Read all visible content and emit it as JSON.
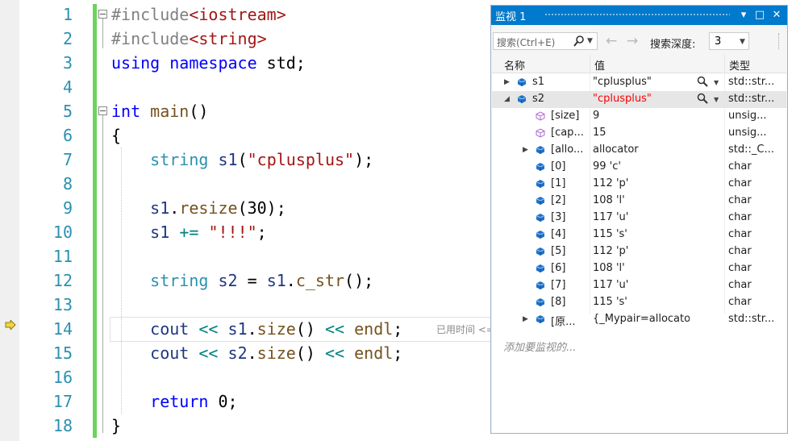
{
  "editor": {
    "line_numbers": [
      "1",
      "2",
      "3",
      "4",
      "5",
      "6",
      "7",
      "8",
      "9",
      "10",
      "11",
      "12",
      "13",
      "14",
      "15",
      "16",
      "17",
      "18"
    ],
    "lines": [
      [
        {
          "c": "p",
          "t": "#include"
        },
        {
          "c": "s",
          "t": "<iostream>"
        }
      ],
      [
        {
          "c": "p",
          "t": "#include"
        },
        {
          "c": "s",
          "t": "<string>"
        }
      ],
      [
        {
          "c": "k",
          "t": "using"
        },
        {
          "c": "",
          "t": " "
        },
        {
          "c": "k",
          "t": "namespace"
        },
        {
          "c": "",
          "t": " std;"
        }
      ],
      [],
      [
        {
          "c": "k",
          "t": "int"
        },
        {
          "c": "",
          "t": " "
        },
        {
          "c": "f",
          "t": "main"
        },
        {
          "c": "",
          "t": "()"
        }
      ],
      [
        {
          "c": "",
          "t": "{"
        }
      ],
      [
        {
          "c": "",
          "t": "    "
        },
        {
          "c": "t",
          "t": "string"
        },
        {
          "c": "",
          "t": " "
        },
        {
          "c": "v",
          "t": "s1"
        },
        {
          "c": "",
          "t": "("
        },
        {
          "c": "s",
          "t": "\"cplusplus\""
        },
        {
          "c": "",
          "t": ");"
        }
      ],
      [],
      [
        {
          "c": "",
          "t": "    "
        },
        {
          "c": "v",
          "t": "s1"
        },
        {
          "c": "",
          "t": "."
        },
        {
          "c": "f",
          "t": "resize"
        },
        {
          "c": "",
          "t": "(30);"
        }
      ],
      [
        {
          "c": "",
          "t": "    "
        },
        {
          "c": "v",
          "t": "s1"
        },
        {
          "c": "",
          "t": " "
        },
        {
          "c": "o",
          "t": "+="
        },
        {
          "c": "",
          "t": " "
        },
        {
          "c": "s",
          "t": "\"!!!\""
        },
        {
          "c": "",
          "t": ";"
        }
      ],
      [],
      [
        {
          "c": "",
          "t": "    "
        },
        {
          "c": "t",
          "t": "string"
        },
        {
          "c": "",
          "t": " "
        },
        {
          "c": "v",
          "t": "s2"
        },
        {
          "c": "",
          "t": " = "
        },
        {
          "c": "v",
          "t": "s1"
        },
        {
          "c": "",
          "t": "."
        },
        {
          "c": "f",
          "t": "c_str"
        },
        {
          "c": "",
          "t": "();"
        }
      ],
      [],
      [
        {
          "c": "",
          "t": "    "
        },
        {
          "c": "v",
          "t": "cout"
        },
        {
          "c": "",
          "t": " "
        },
        {
          "c": "o",
          "t": "<<"
        },
        {
          "c": "",
          "t": " "
        },
        {
          "c": "v",
          "t": "s1"
        },
        {
          "c": "",
          "t": "."
        },
        {
          "c": "f",
          "t": "size"
        },
        {
          "c": "",
          "t": "() "
        },
        {
          "c": "o",
          "t": "<<"
        },
        {
          "c": "",
          "t": " "
        },
        {
          "c": "f",
          "t": "endl"
        },
        {
          "c": "",
          "t": ";"
        }
      ],
      [
        {
          "c": "",
          "t": "    "
        },
        {
          "c": "v",
          "t": "cout"
        },
        {
          "c": "",
          "t": " "
        },
        {
          "c": "o",
          "t": "<<"
        },
        {
          "c": "",
          "t": " "
        },
        {
          "c": "v",
          "t": "s2"
        },
        {
          "c": "",
          "t": "."
        },
        {
          "c": "f",
          "t": "size"
        },
        {
          "c": "",
          "t": "() "
        },
        {
          "c": "o",
          "t": "<<"
        },
        {
          "c": "",
          "t": " "
        },
        {
          "c": "f",
          "t": "endl"
        },
        {
          "c": "",
          "t": ";"
        }
      ],
      [],
      [
        {
          "c": "",
          "t": "    "
        },
        {
          "c": "k",
          "t": "return"
        },
        {
          "c": "",
          "t": " 0;"
        }
      ],
      [
        {
          "c": "",
          "t": "}"
        }
      ]
    ],
    "perf_tip": "已用时间 <="
  },
  "watch": {
    "title": "监视 1",
    "buttons": {
      "dropdown": "▾",
      "maximize": "□",
      "close": "✕"
    },
    "search_placeholder": "搜索(Ctrl+E)",
    "depth_label": "搜索深度:",
    "depth_value": "3",
    "columns": {
      "name": "名称",
      "value": "值",
      "type": "类型"
    },
    "rows": [
      {
        "exp": "▶",
        "name": "s1",
        "value": "\"cplusplus\"",
        "type": "std::str...",
        "icon": "object",
        "indent": 0,
        "mag": true
      },
      {
        "exp": "◢",
        "name": "s2",
        "value": "\"cplusplus\"",
        "type": "std::str...",
        "icon": "object",
        "indent": 0,
        "mag": true,
        "selected": true,
        "red": true
      },
      {
        "exp": "",
        "name": "[size]",
        "value": "9",
        "type": "unsig...",
        "icon": "field",
        "indent": 1
      },
      {
        "exp": "",
        "name": "[cap...",
        "value": "15",
        "type": "unsig...",
        "icon": "field",
        "indent": 1
      },
      {
        "exp": "▶",
        "name": "[allo...",
        "value": "allocator",
        "type": "std::_C...",
        "icon": "object",
        "indent": 1
      },
      {
        "exp": "",
        "name": "[0]",
        "value": "99 'c'",
        "type": "char",
        "icon": "object",
        "indent": 1
      },
      {
        "exp": "",
        "name": "[1]",
        "value": "112 'p'",
        "type": "char",
        "icon": "object",
        "indent": 1
      },
      {
        "exp": "",
        "name": "[2]",
        "value": "108 'l'",
        "type": "char",
        "icon": "object",
        "indent": 1
      },
      {
        "exp": "",
        "name": "[3]",
        "value": "117 'u'",
        "type": "char",
        "icon": "object",
        "indent": 1
      },
      {
        "exp": "",
        "name": "[4]",
        "value": "115 's'",
        "type": "char",
        "icon": "object",
        "indent": 1
      },
      {
        "exp": "",
        "name": "[5]",
        "value": "112 'p'",
        "type": "char",
        "icon": "object",
        "indent": 1
      },
      {
        "exp": "",
        "name": "[6]",
        "value": "108 'l'",
        "type": "char",
        "icon": "object",
        "indent": 1
      },
      {
        "exp": "",
        "name": "[7]",
        "value": "117 'u'",
        "type": "char",
        "icon": "object",
        "indent": 1
      },
      {
        "exp": "",
        "name": "[8]",
        "value": "115 's'",
        "type": "char",
        "icon": "object",
        "indent": 1
      },
      {
        "exp": "▶",
        "name": "[原...",
        "value": "{_Mypair=allocator }",
        "type": "std::str...",
        "icon": "object",
        "indent": 1
      }
    ],
    "add_watch": "添加要监视的..."
  },
  "colors": {
    "accent": "#007acc",
    "change_bar": "#6cd35c",
    "line_number": "#2b91af",
    "keyword": "#0000ff",
    "string": "#a31515",
    "type": "#2b91af",
    "function": "#74531f",
    "changed_value": "#ff0000"
  }
}
